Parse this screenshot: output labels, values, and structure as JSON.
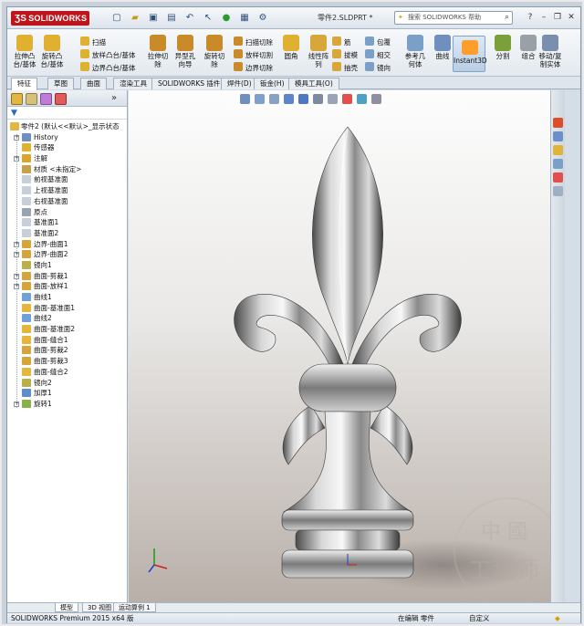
{
  "app": {
    "brand": "SOLIDWORKS",
    "document_title": "零件2.SLDPRT *",
    "search_placeholder": "搜索 SOLIDWORKS 帮助"
  },
  "ribbon": {
    "large_buttons": [
      {
        "label": "拉伸凸\n台/基体",
        "icon": "extrude-boss-icon"
      },
      {
        "label": "旋转凸\n台/基体",
        "icon": "revolve-boss-icon"
      },
      {
        "label": "拉伸切\n除",
        "icon": "extrude-cut-icon"
      },
      {
        "label": "异型孔\n向导",
        "icon": "hole-wizard-icon"
      },
      {
        "label": "旋转切\n除",
        "icon": "revolve-cut-icon"
      },
      {
        "label": "圆角",
        "icon": "fillet-icon"
      },
      {
        "label": "线性阵\n列",
        "icon": "linear-pattern-icon"
      },
      {
        "label": "参考几\n何体",
        "icon": "reference-geometry-icon"
      },
      {
        "label": "曲线",
        "icon": "curves-icon"
      },
      {
        "label": "Instant3D",
        "icon": "instant3d-icon"
      },
      {
        "label": "分割",
        "icon": "split-icon"
      },
      {
        "label": "组合",
        "icon": "combine-icon"
      },
      {
        "label": "移动/复\n制实体",
        "icon": "move-copy-icon"
      }
    ],
    "small_buttons": [
      {
        "label": "扫描",
        "icon": "sweep-icon"
      },
      {
        "label": "放样凸台/基体",
        "icon": "loft-boss-icon"
      },
      {
        "label": "边界凸台/基体",
        "icon": "boundary-boss-icon"
      },
      {
        "label": "扫描切除",
        "icon": "swept-cut-icon"
      },
      {
        "label": "放样切割",
        "icon": "lofted-cut-icon"
      },
      {
        "label": "边界切除",
        "icon": "boundary-cut-icon"
      },
      {
        "label": "筋",
        "icon": "rib-icon"
      },
      {
        "label": "拔模",
        "icon": "draft-icon"
      },
      {
        "label": "抽壳",
        "icon": "shell-icon"
      },
      {
        "label": "包覆",
        "icon": "wrap-icon"
      },
      {
        "label": "相交",
        "icon": "intersect-icon"
      },
      {
        "label": "镜向",
        "icon": "mirror-icon"
      }
    ]
  },
  "tabs": [
    "特征",
    "草图",
    "曲面",
    "渲染工具",
    "SOLIDWORKS 插件",
    "焊件(D)",
    "钣金(H)",
    "模具工具(O)"
  ],
  "feature_tree": {
    "root": "零件2 (默认<<默认>_显示状态",
    "items": [
      {
        "label": "History",
        "expand": "+",
        "color": "#6d8fc2"
      },
      {
        "label": "传感器",
        "expand": "",
        "color": "#e0b030"
      },
      {
        "label": "注解",
        "expand": "+",
        "color": "#d9a52a"
      },
      {
        "label": "材质 <未指定>",
        "expand": "",
        "color": "#c8a04a"
      },
      {
        "label": "前视基准面",
        "expand": "",
        "color": "#c7cfd8"
      },
      {
        "label": "上视基准面",
        "expand": "",
        "color": "#c7cfd8"
      },
      {
        "label": "右视基准面",
        "expand": "",
        "color": "#c7cfd8"
      },
      {
        "label": "原点",
        "expand": "",
        "color": "#9aa4ae"
      },
      {
        "label": "基准面1",
        "expand": "",
        "color": "#c7cfd8"
      },
      {
        "label": "基准面2",
        "expand": "",
        "color": "#c7cfd8"
      },
      {
        "label": "边界-曲面1",
        "expand": "+",
        "color": "#d6a43a"
      },
      {
        "label": "边界-曲面2",
        "expand": "+",
        "color": "#d6a43a"
      },
      {
        "label": "镜向1",
        "expand": "",
        "color": "#b9b04a"
      },
      {
        "label": "曲面-剪裁1",
        "expand": "+",
        "color": "#d6a43a"
      },
      {
        "label": "曲面-放样1",
        "expand": "+",
        "color": "#d6a43a"
      },
      {
        "label": "曲线1",
        "expand": "",
        "color": "#6fa0d8"
      },
      {
        "label": "曲面-基准面1",
        "expand": "",
        "color": "#e6b53b"
      },
      {
        "label": "曲线2",
        "expand": "",
        "color": "#6fa0d8"
      },
      {
        "label": "曲面-基准面2",
        "expand": "",
        "color": "#e6b53b"
      },
      {
        "label": "曲面-缝合1",
        "expand": "",
        "color": "#e6b53b"
      },
      {
        "label": "曲面-剪裁2",
        "expand": "",
        "color": "#d6a43a"
      },
      {
        "label": "曲面-剪裁3",
        "expand": "",
        "color": "#d6a43a"
      },
      {
        "label": "曲面-缝合2",
        "expand": "",
        "color": "#e6b53b"
      },
      {
        "label": "镜向2",
        "expand": "",
        "color": "#b9b04a"
      },
      {
        "label": "加厚1",
        "expand": "",
        "color": "#5f8fc9"
      },
      {
        "label": "旋转1",
        "expand": "+",
        "color": "#8ab04a"
      }
    ]
  },
  "model_tabs": [
    "模型",
    "3D 视图",
    "运动算例 1"
  ],
  "status": {
    "left": "SOLIDWORKS Premium 2015 x64 版",
    "mode": "在编辑 零件",
    "custom": "自定义"
  },
  "watermark": {
    "top": "中 國",
    "bottom": "工程师"
  }
}
